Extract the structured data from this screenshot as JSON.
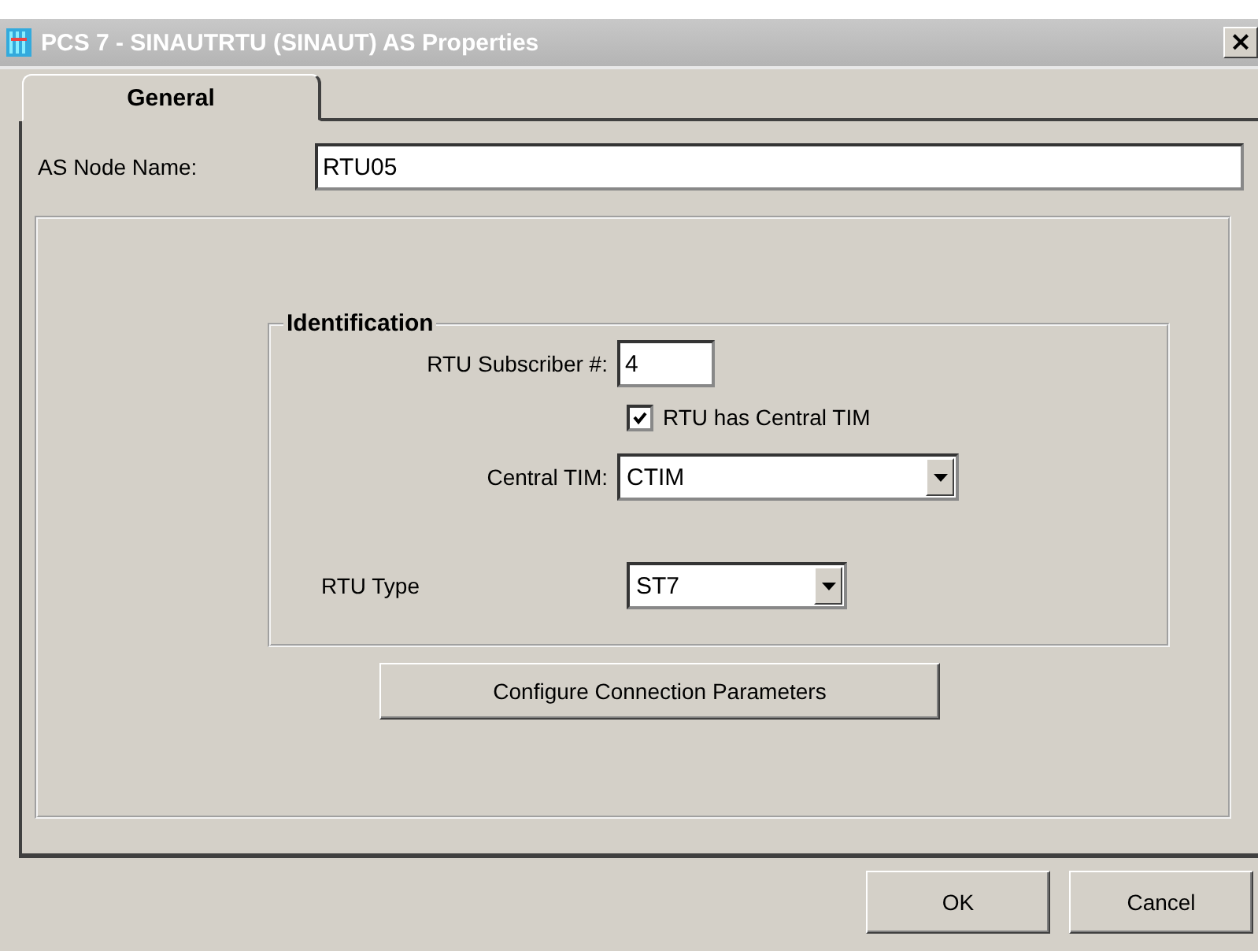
{
  "window": {
    "title": "PCS 7 - SINAUTRTU (SINAUT) AS Properties",
    "close": "×"
  },
  "tabs": [
    {
      "label": "General",
      "selected": true
    }
  ],
  "node_name": {
    "label": "AS Node Name:",
    "value": "RTU05"
  },
  "identification": {
    "title": "Identification",
    "subscriber": {
      "label": "RTU Subscriber #:",
      "value": "4"
    },
    "central_tim_checkbox": {
      "label": "RTU has Central TIM",
      "checked": true
    },
    "central_tim": {
      "label": "Central TIM:",
      "value": "CTIM"
    },
    "rtu_type": {
      "label": "RTU Type",
      "value": "ST7"
    }
  },
  "configure_button": "Configure Connection Parameters",
  "buttons": [
    "OK",
    "Cancel"
  ]
}
